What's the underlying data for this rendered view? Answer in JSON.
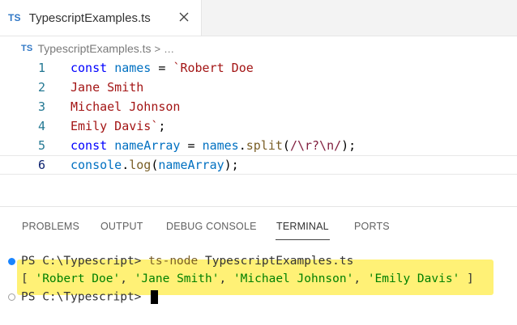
{
  "tab": {
    "badge": "TS",
    "title": "TypescriptExamples.ts",
    "close_icon": "close-icon"
  },
  "breadcrumb": {
    "badge": "TS",
    "file": "TypescriptExamples.ts",
    "separator": ">",
    "more": "…"
  },
  "editor": {
    "lines": [
      {
        "number": "1",
        "tokens": [
          "const",
          " ",
          "names",
          " = ",
          "`Robert Doe"
        ]
      },
      {
        "number": "2",
        "tokens": [
          "Jane Smith"
        ]
      },
      {
        "number": "3",
        "tokens": [
          "Michael Johnson"
        ]
      },
      {
        "number": "4",
        "tokens": [
          "Emily Davis`",
          ";"
        ]
      },
      {
        "number": "5",
        "tokens": [
          "const",
          " ",
          "nameArray",
          " = ",
          "names",
          ".",
          "split",
          "(",
          "/\\r?\\n/",
          ");"
        ]
      },
      {
        "number": "6",
        "tokens": [
          "console",
          ".",
          "log",
          "(",
          "nameArray",
          ");"
        ]
      }
    ],
    "active_line": 6
  },
  "panel": {
    "tabs": [
      "PROBLEMS",
      "OUTPUT",
      "DEBUG CONSOLE",
      "TERMINAL",
      "PORTS"
    ],
    "active_tab": "TERMINAL"
  },
  "terminal": {
    "line1_prompt": "PS C:\\Typescript> ",
    "line1_cmd": "ts-node",
    "line1_args": " TypescriptExamples.ts",
    "output_open": "[ ",
    "output_items": [
      "'Robert Doe'",
      "'Jane Smith'",
      "'Michael Johnson'",
      "'Emily Davis'"
    ],
    "output_sep": ", ",
    "output_close": " ]",
    "line3_prompt": "PS C:\\Typescript> "
  },
  "colors": {
    "ts_blue": "#3178c6",
    "keyword": "#0000ff",
    "variable": "#0070c1",
    "string": "#a31515",
    "highlight": "#fff176"
  }
}
